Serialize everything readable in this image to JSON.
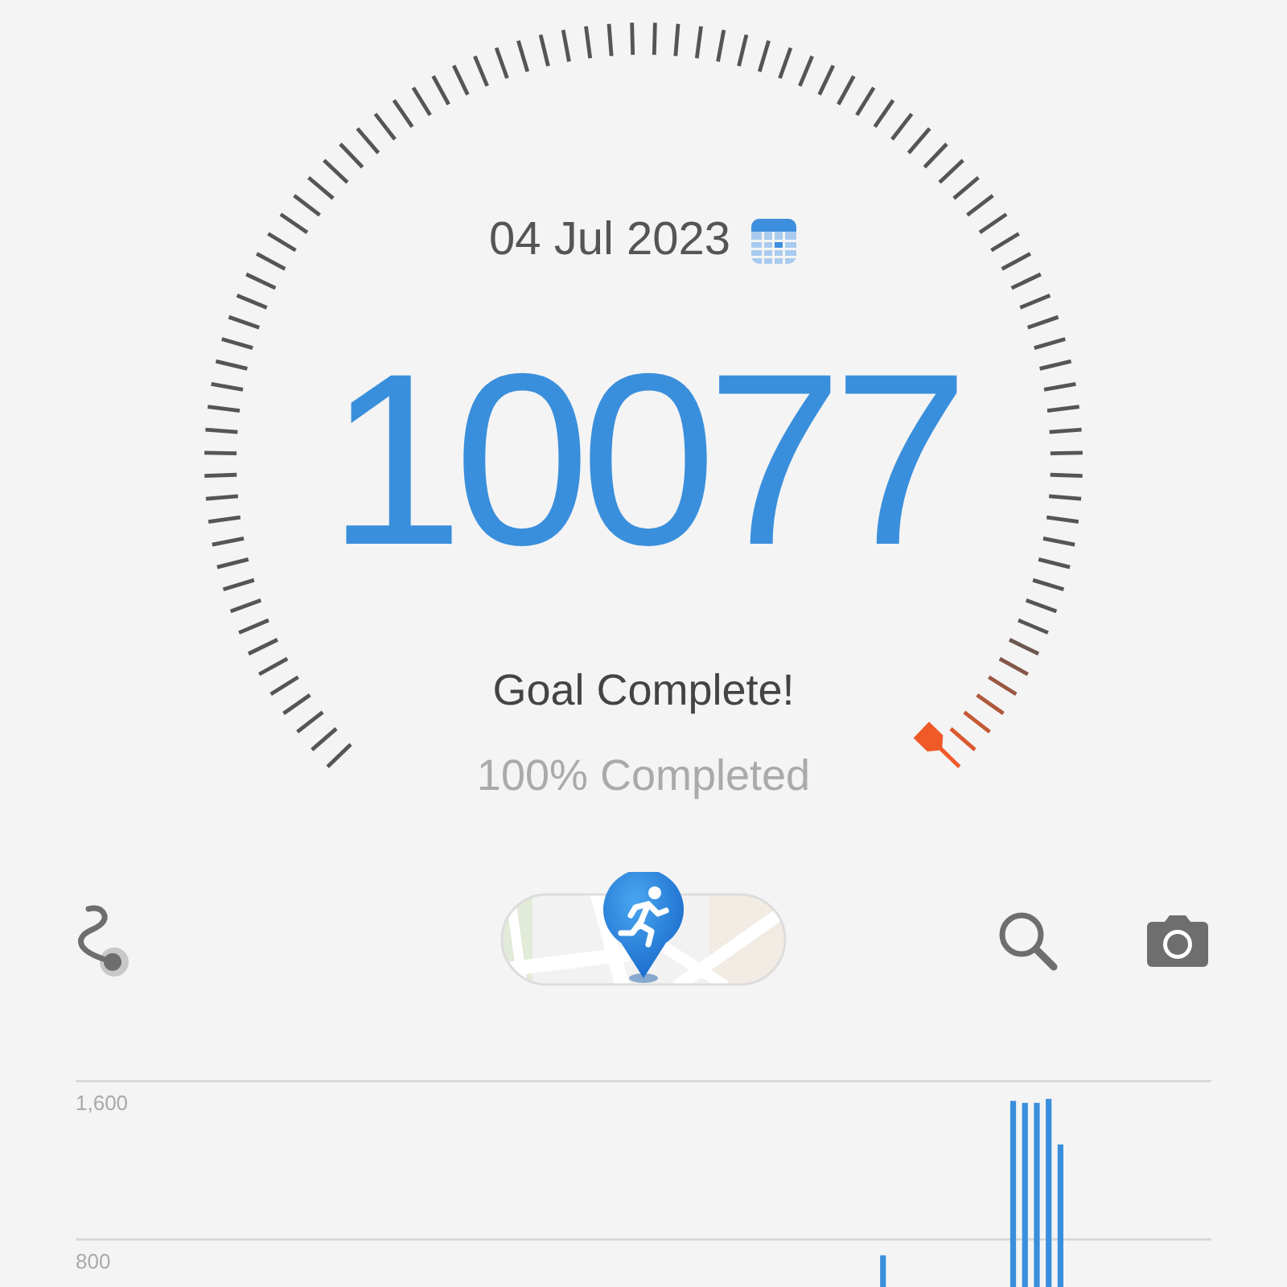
{
  "gauge": {
    "date": "04 Jul 2023",
    "steps": "10077",
    "status": "Goal Complete!",
    "progress_text": "100% Completed"
  },
  "chart_data": {
    "type": "bar",
    "ylim": [
      560,
      1600
    ],
    "yticks": [
      {
        "value": 800,
        "label": "800"
      },
      {
        "value": 1600,
        "label": "1,600"
      }
    ],
    "values": [
      null,
      null,
      null,
      null,
      null,
      null,
      null,
      null,
      null,
      null,
      null,
      null,
      null,
      null,
      null,
      null,
      null,
      null,
      null,
      null,
      null,
      null,
      null,
      null,
      null,
      null,
      null,
      null,
      null,
      null,
      null,
      null,
      null,
      null,
      null,
      null,
      null,
      null,
      null,
      null,
      null,
      null,
      null,
      null,
      null,
      null,
      null,
      null,
      null,
      null,
      null,
      null,
      null,
      null,
      null,
      null,
      null,
      null,
      null,
      null,
      null,
      null,
      null,
      null,
      null,
      null,
      null,
      null,
      720,
      null,
      null,
      null,
      null,
      null,
      null,
      null,
      null,
      null,
      null,
      1500,
      1490,
      1490,
      1510,
      1280,
      null,
      null,
      null,
      null,
      null,
      null,
      null,
      null,
      null,
      null,
      null,
      null
    ]
  }
}
